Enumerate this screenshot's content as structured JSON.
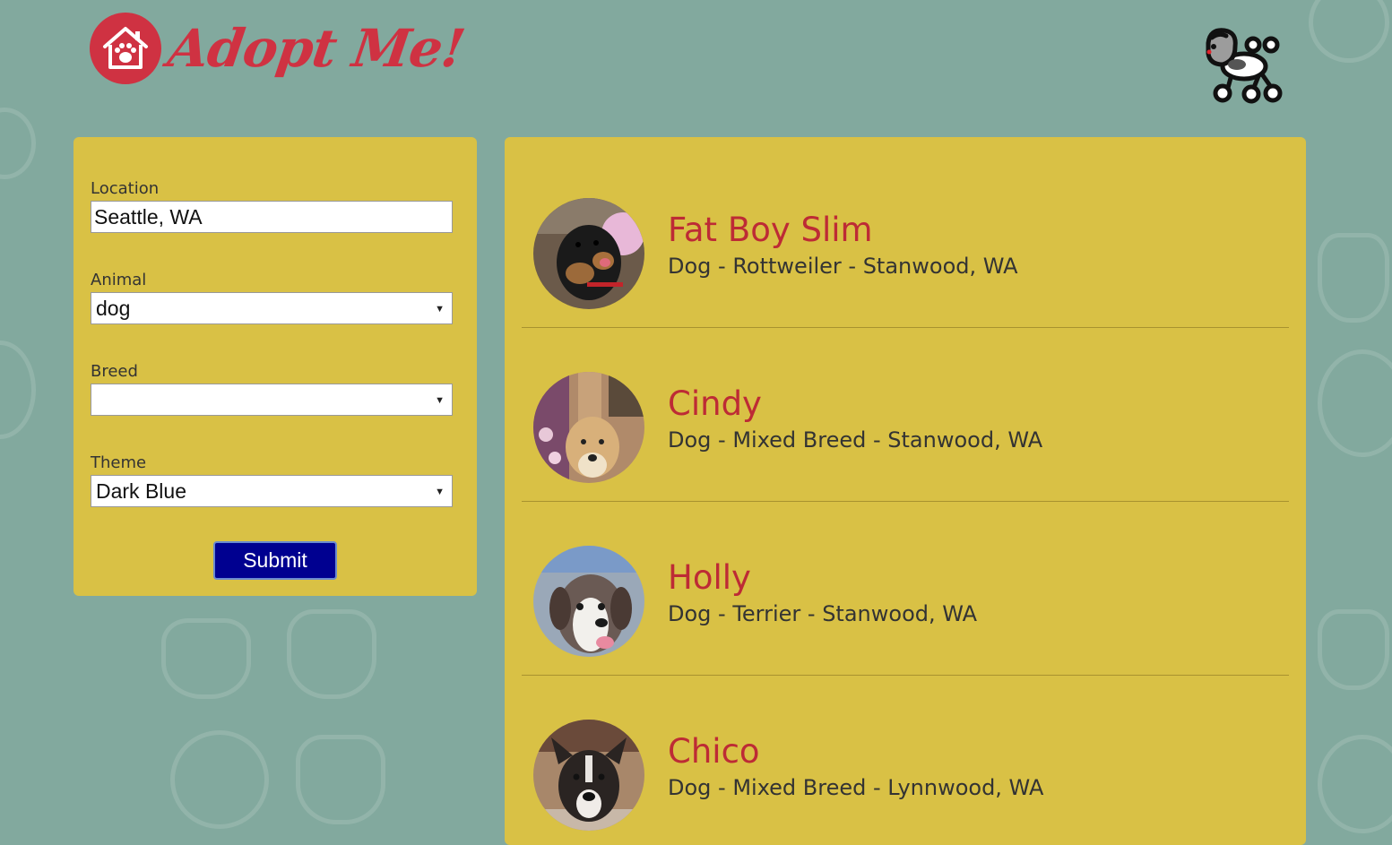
{
  "brand": {
    "name": "Adopt Me!",
    "logo_icon": "house-paw-icon",
    "accent": "#cf3242"
  },
  "header": {
    "mascot_icon": "poodle-icon"
  },
  "search": {
    "location_label": "Location",
    "location_value": "Seattle, WA",
    "animal_label": "Animal",
    "animal_value": "dog",
    "breed_label": "Breed",
    "breed_value": "",
    "theme_label": "Theme",
    "theme_value": "Dark Blue",
    "submit_label": "Submit",
    "submit_color": "#000090"
  },
  "results": [
    {
      "name": "Fat Boy Slim",
      "info": "Dog - Rottweiler - Stanwood, WA"
    },
    {
      "name": "Cindy",
      "info": "Dog - Mixed Breed - Stanwood, WA"
    },
    {
      "name": "Holly",
      "info": "Dog - Terrier - Stanwood, WA"
    },
    {
      "name": "Chico",
      "info": "Dog - Mixed Breed - Lynnwood, WA"
    }
  ],
  "colors": {
    "background": "#82a99e",
    "panel": "#d9c145",
    "pet_name": "#bd2b35"
  }
}
